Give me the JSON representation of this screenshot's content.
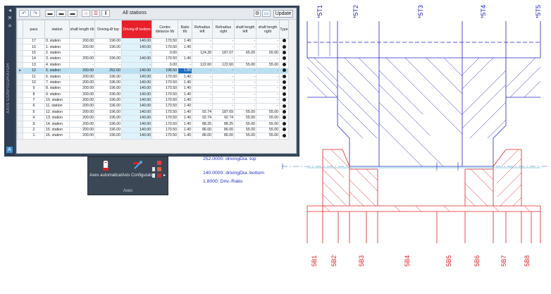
{
  "panel": {
    "toolbar": {
      "station_label": "All stations",
      "update_label": "Update"
    },
    "sidebar_title": "AXIS CONFIGURATOR",
    "columns": [
      "pass",
      "station",
      "shaft length t/b",
      "Driving-Ø top",
      "Driving-Ø bottom",
      "Centre distance t/b",
      "Ratio t/b",
      "Refradius left",
      "Refradius right",
      "shaft length left",
      "shaft length right",
      "Type"
    ],
    "rows": [
      {
        "pass": "17",
        "station": "0. station",
        "c1": "200.00",
        "c2": "196.00",
        "c3": "140.00",
        "c4": "170.50",
        "c5": "1.40",
        "c6": "-",
        "c7": "-",
        "c8": "-",
        "c9": "-"
      },
      {
        "pass": "16",
        "station": "1. station",
        "c1": "200.00",
        "c2": "196.00",
        "c3": "140.00",
        "c4": "170.50",
        "c5": "1.40",
        "c6": "-",
        "c7": "-",
        "c8": "-",
        "c9": "-"
      },
      {
        "pass": "15",
        "station": "2. station",
        "c1": "-",
        "c2": "-",
        "c3": "-",
        "c4": "0.00",
        "c5": "-",
        "c6": "124.39",
        "c7": "187.07",
        "c8": "65.00",
        "c9": "65.00"
      },
      {
        "pass": "14",
        "station": "3. station",
        "c1": "200.00",
        "c2": "196.00",
        "c3": "140.00",
        "c4": "170.50",
        "c5": "1.40",
        "c6": "-",
        "c7": "-",
        "c8": "-",
        "c9": "-"
      },
      {
        "pass": "13",
        "station": "4. station",
        "c1": "-",
        "c2": "-",
        "c3": "-",
        "c4": "0.00",
        "c5": "-",
        "c6": "122.60",
        "c7": "122.60",
        "c8": "55.00",
        "c9": "55.00"
      },
      {
        "pass": "12",
        "station": "5. station",
        "c1": "200.00",
        "c2": "252.00",
        "c3": "140.00",
        "c4": "198.50",
        "c5": "1.80",
        "c6": "-",
        "c7": "-",
        "c8": "-",
        "c9": "-",
        "selected": true
      },
      {
        "pass": "11",
        "station": "6. station",
        "c1": "200.00",
        "c2": "196.00",
        "c3": "140.00",
        "c4": "170.50",
        "c5": "1.40",
        "c6": "-",
        "c7": "-",
        "c8": "-",
        "c9": "-"
      },
      {
        "pass": "10",
        "station": "7. station",
        "c1": "200.00",
        "c2": "196.00",
        "c3": "140.00",
        "c4": "170.50",
        "c5": "1.40",
        "c6": "-",
        "c7": "-",
        "c8": "-",
        "c9": "-"
      },
      {
        "pass": "9",
        "station": "8. station",
        "c1": "200.00",
        "c2": "196.00",
        "c3": "140.00",
        "c4": "170.50",
        "c5": "1.40",
        "c6": "-",
        "c7": "-",
        "c8": "-",
        "c9": "-"
      },
      {
        "pass": "8",
        "station": "9. station",
        "c1": "200.00",
        "c2": "196.00",
        "c3": "140.00",
        "c4": "170.50",
        "c5": "1.40",
        "c6": "-",
        "c7": "-",
        "c8": "-",
        "c9": "-"
      },
      {
        "pass": "7",
        "station": "10. station",
        "c1": "200.00",
        "c2": "196.00",
        "c3": "140.00",
        "c4": "170.50",
        "c5": "1.40",
        "c6": "-",
        "c7": "-",
        "c8": "-",
        "c9": "-"
      },
      {
        "pass": "6",
        "station": "11. station",
        "c1": "200.00",
        "c2": "196.00",
        "c3": "140.00",
        "c4": "170.50",
        "c5": "1.40",
        "c6": "-",
        "c7": "-",
        "c8": "-",
        "c9": "-"
      },
      {
        "pass": "5",
        "station": "12. station",
        "c1": "200.00",
        "c2": "196.00",
        "c3": "140.00",
        "c4": "170.50",
        "c5": "1.40",
        "c6": "92.74",
        "c7": "187.69",
        "c8": "55.00",
        "c9": "55.00"
      },
      {
        "pass": "4",
        "station": "13. station",
        "c1": "200.00",
        "c2": "196.00",
        "c3": "140.00",
        "c4": "170.50",
        "c5": "1.40",
        "c6": "92.74",
        "c7": "92.74",
        "c8": "55.00",
        "c9": "55.00"
      },
      {
        "pass": "3",
        "station": "14. station",
        "c1": "200.00",
        "c2": "196.00",
        "c3": "140.00",
        "c4": "170.50",
        "c5": "1.40",
        "c6": "88.25",
        "c7": "88.25",
        "c8": "55.00",
        "c9": "55.00"
      },
      {
        "pass": "2",
        "station": "15. station",
        "c1": "200.00",
        "c2": "196.00",
        "c3": "140.00",
        "c4": "170.50",
        "c5": "1.40",
        "c6": "86.00",
        "c7": "86.00",
        "c8": "55.00",
        "c9": "55.00"
      },
      {
        "pass": "1",
        "station": "16. station",
        "c1": "200.00",
        "c2": "196.00",
        "c3": "140.00",
        "c4": "170.50",
        "c5": "1.40",
        "c6": "86.00",
        "c7": "86.00",
        "c8": "55.00",
        "c9": "55.00"
      }
    ]
  },
  "ribbon": {
    "axes_auto_label": "Axes automatical",
    "axis_config_label": "Axis Configurator",
    "group_title": "Axes"
  },
  "annotation": {
    "line1": "252.0000: drivingDia. top",
    "line2": "140.0000: drivingDia. bottom",
    "line3": "1.8000: Driv.-Ratio"
  },
  "cad": {
    "top_labels": [
      "*5T1",
      "*5T2",
      "*5T3",
      "*5T4",
      "*5T5"
    ],
    "bottom_labels": [
      "5B1",
      "5B2",
      "5B3",
      "5B4",
      "5B5",
      "5B6",
      "5B7",
      "5B8"
    ],
    "colors": {
      "top": "#2020c8",
      "bottom": "#e02020",
      "highlight": "#e8202a",
      "selected": "#1e6fc2"
    }
  }
}
